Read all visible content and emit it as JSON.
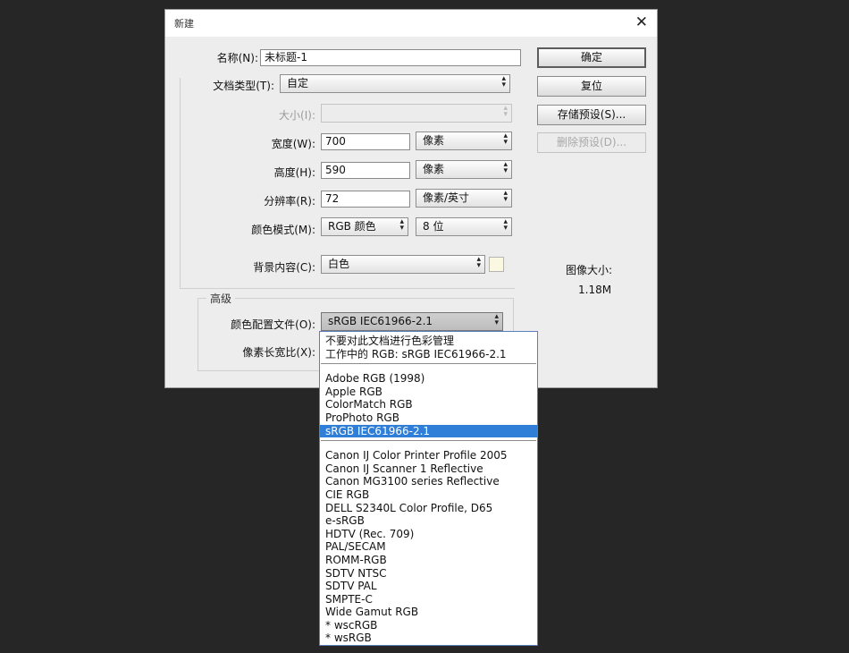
{
  "dialog": {
    "title": "新建",
    "close_glyph": "✕",
    "name_label": "名称(N):",
    "name_value": "未标题-1",
    "preset_label": "文档类型(T):",
    "preset_value": "自定",
    "size_label": "大小(I):",
    "size_value": "",
    "width_label": "宽度(W):",
    "width_value": "700",
    "width_unit": "像素",
    "height_label": "高度(H):",
    "height_value": "590",
    "height_unit": "像素",
    "resolution_label": "分辨率(R):",
    "resolution_value": "72",
    "resolution_unit": "像素/英寸",
    "color_mode_label": "颜色模式(M):",
    "color_mode_value": "RGB 颜色",
    "bit_depth_value": "8 位",
    "background_label": "背景内容(C):",
    "background_value": "白色",
    "background_swatch_color": "#fbf8e1",
    "advanced_title": "高级",
    "color_profile_label": "颜色配置文件(O):",
    "color_profile_value": "sRGB IEC61966-2.1",
    "pixel_aspect_label": "像素长宽比(X):",
    "image_size_label": "图像大小:",
    "image_size_value": "1.18M",
    "buttons": {
      "ok": "确定",
      "reset": "复位",
      "save_preset": "存储预设(S)...",
      "delete_preset": "删除预设(D)..."
    }
  },
  "dropdown": {
    "group1": [
      "不要对此文档进行色彩管理",
      "工作中的 RGB: sRGB IEC61966-2.1"
    ],
    "group2": [
      "Adobe RGB (1998)",
      "Apple RGB",
      "ColorMatch RGB",
      "ProPhoto RGB",
      "sRGB IEC61966-2.1"
    ],
    "group2_selected_index": 4,
    "group3": [
      "Canon IJ Color Printer Profile 2005",
      "Canon IJ Scanner 1 Reflective",
      "Canon MG3100 series Reflective",
      "CIE RGB",
      "DELL S2340L Color Profile, D65",
      "e-sRGB",
      "HDTV (Rec. 709)",
      "PAL/SECAM",
      "ROMM-RGB",
      "SDTV NTSC",
      "SDTV PAL",
      "SMPTE-C",
      "Wide Gamut RGB",
      "* wscRGB",
      "* wsRGB"
    ],
    "selected_color": "#2f7fd8"
  },
  "icons": {
    "dropdown_arrow": "updown-arrow-icon"
  }
}
